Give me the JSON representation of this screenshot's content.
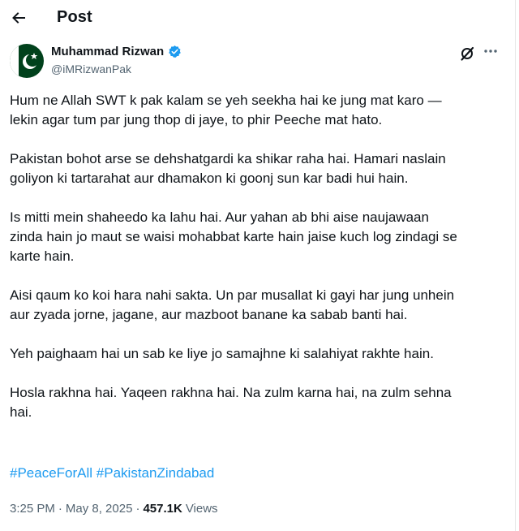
{
  "header": {
    "title": "Post"
  },
  "author": {
    "name": "Muhammad Rizwan",
    "handle": "@iMRizwanPak",
    "verified": true
  },
  "post": {
    "paragraphs": [
      "Hum ne Allah SWT k pak kalam se yeh seekha hai ke jung mat karo —\nlekin agar tum par jung thop di jaye, to phir Peeche mat hato.",
      "Pakistan bohot arse se dehshatgardi ka shikar raha hai. Hamari naslain\ngoliyon ki tartarahat aur dhamakon ki goonj sun kar badi hui hain.",
      "Is mitti mein shaheedo ka lahu hai. Aur yahan ab bhi aise naujawaan\nzinda hain jo maut se waisi mohabbat karte hain jaise kuch log zindagi se\nkarte hain.",
      "Aisi qaum ko koi hara nahi sakta. Un par musallat ki gayi har jung unhein\naur zyada jorne, jagane, aur mazboot banane ka sabab banti hai.",
      "Yeh paighaam hai un sab ke liye jo samajhne ki salahiyat rakhte hain.",
      "Hosla rakhna hai. Yaqeen rakhna hai. Na zulm karna hai, na zulm sehna\nhai."
    ],
    "hashtags": [
      "#PeaceForAll",
      "#PakistanZindabad"
    ]
  },
  "meta": {
    "time": "3:25 PM",
    "date": "May 8, 2025",
    "views_count": "457.1K",
    "views_label": "Views"
  },
  "icons": {
    "back": "arrow-left-icon",
    "verified": "verified-badge-icon",
    "grok": "grok-icon",
    "more": "more-horizontal-icon"
  },
  "colors": {
    "link": "#1d9bf0",
    "text": "#0f1419",
    "secondary": "#536471",
    "pakistan_green": "#01411c"
  }
}
